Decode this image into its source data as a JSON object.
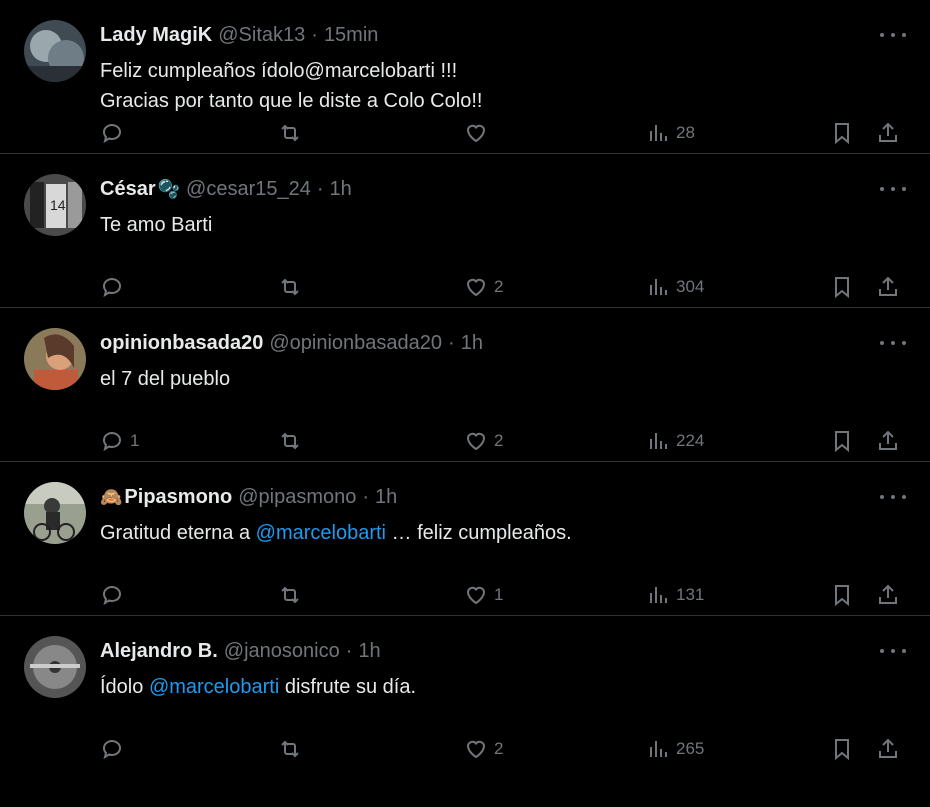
{
  "tweets": [
    {
      "name": "Lady MagiK",
      "handle": "@Sitak13",
      "sep": "·",
      "time": "15min",
      "emoji": "",
      "line1": "Feliz cumpleaños ídolo@marcelobarti !!!",
      "line2": "Gracias por tanto que le diste a Colo Colo!!",
      "replies": "",
      "likes": "",
      "views": "28",
      "avatar_color": "#6f7d86"
    },
    {
      "name": "César",
      "handle": "@cesar15_24",
      "sep": "·",
      "time": "1h",
      "emoji": "🫧",
      "line1": "Te amo Barti",
      "line2": "",
      "replies": "",
      "likes": "2",
      "views": "304",
      "avatar_color": "#8a8a8a"
    },
    {
      "name": "opinionbasada20",
      "handle": "@opinionbasada20",
      "sep": "·",
      "time": "1h",
      "emoji": "",
      "line1": "el 7 del pueblo",
      "line2": "",
      "replies": "1",
      "likes": "2",
      "views": "224",
      "avatar_color": "#b06a4a"
    },
    {
      "name": "Pipasmono",
      "handle": "@pipasmono",
      "sep": "·",
      "time": "1h",
      "emoji": "🙈",
      "text_prefix": "Gratitud eterna a ",
      "mention": "@marcelobarti",
      "text_suffix": " … feliz cumpleaños.",
      "replies": "",
      "likes": "1",
      "views": "131",
      "avatar_color": "#7a8a70"
    },
    {
      "name": "Alejandro B.",
      "handle": "@janosonico",
      "sep": "·",
      "time": "1h",
      "emoji": "",
      "text_prefix": "Ídolo ",
      "mention": "@marcelobarti",
      "text_suffix": " disfrute su día.",
      "replies": "",
      "likes": "2",
      "views": "265",
      "avatar_color": "#5a5a5a"
    }
  ]
}
